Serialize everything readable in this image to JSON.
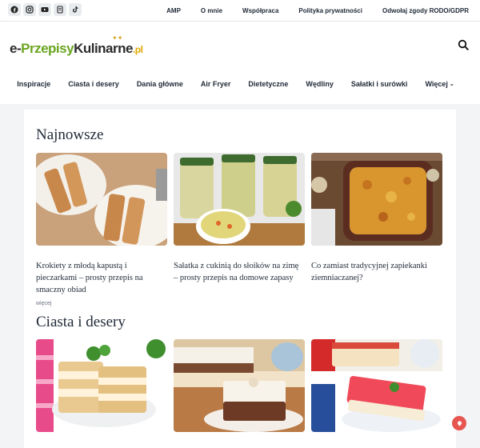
{
  "top_links": [
    "AMP",
    "O mnie",
    "Współpraca",
    "Polityka prywatności",
    "Odwołaj zgody RODO/GDPR"
  ],
  "socials": [
    {
      "name": "facebook-icon"
    },
    {
      "name": "instagram-icon"
    },
    {
      "name": "youtube-icon"
    },
    {
      "name": "mix-icon"
    },
    {
      "name": "tiktok-icon"
    }
  ],
  "logo": {
    "part1": "e-",
    "part2": "Przepisy",
    "part3": "Kulinarne",
    "part4": ".pl"
  },
  "nav": [
    "Inspiracje",
    "Ciasta i desery",
    "Dania główne",
    "Air Fryer",
    "Dietetyczne",
    "Wędliny",
    "Sałatki i surówki",
    "Więcej"
  ],
  "sections": [
    {
      "title": "Najnowsze",
      "posts": [
        {
          "title": "Krokiety z młodą kapustą i pieczarkami – prosty przepis na smaczny obiad",
          "meta": "więcej"
        },
        {
          "title": "Sałatka z cukinią do słoików na zimę – prosty przepis na domowe zapasy",
          "meta": ""
        },
        {
          "title": "Co zamiast tradycyjnej zapiekanki ziemniaczanej?",
          "meta": ""
        }
      ]
    },
    {
      "title": "Ciasta i desery",
      "posts": [
        {
          "title": ""
        },
        {
          "title": ""
        },
        {
          "title": ""
        }
      ]
    }
  ],
  "colors": {
    "brand_green": "#6aa51f",
    "accent_red": "#e6554f",
    "background": "#f3f4f6"
  }
}
